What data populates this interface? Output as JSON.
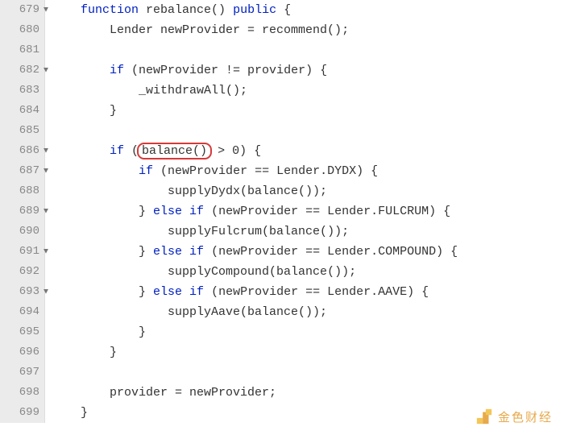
{
  "watermark": {
    "text": "金色财经"
  },
  "lines": [
    {
      "num": "679",
      "fold": true,
      "indent": 4,
      "tokens": [
        {
          "t": "function ",
          "c": "kw"
        },
        {
          "t": "rebalance"
        },
        {
          "t": "() "
        },
        {
          "t": "public",
          "c": "kw"
        },
        {
          "t": " {"
        }
      ]
    },
    {
      "num": "680",
      "fold": false,
      "indent": 8,
      "tokens": [
        {
          "t": "Lender newProvider = recommend();"
        }
      ]
    },
    {
      "num": "681",
      "fold": false,
      "indent": 0,
      "tokens": []
    },
    {
      "num": "682",
      "fold": true,
      "indent": 8,
      "tokens": [
        {
          "t": "if",
          "c": "kw"
        },
        {
          "t": " (newProvider != provider) {"
        }
      ]
    },
    {
      "num": "683",
      "fold": false,
      "indent": 12,
      "tokens": [
        {
          "t": "_withdrawAll();"
        }
      ]
    },
    {
      "num": "684",
      "fold": false,
      "indent": 8,
      "tokens": [
        {
          "t": "}"
        }
      ]
    },
    {
      "num": "685",
      "fold": false,
      "indent": 0,
      "tokens": []
    },
    {
      "num": "686",
      "fold": true,
      "indent": 8,
      "tokens": [
        {
          "t": "if",
          "c": "kw"
        },
        {
          "t": " ("
        },
        {
          "t": "balance()",
          "hl": true
        },
        {
          "t": " > 0) {"
        }
      ]
    },
    {
      "num": "687",
      "fold": true,
      "indent": 12,
      "tokens": [
        {
          "t": "if",
          "c": "kw"
        },
        {
          "t": " (newProvider == Lender.DYDX) {"
        }
      ]
    },
    {
      "num": "688",
      "fold": false,
      "indent": 16,
      "tokens": [
        {
          "t": "supplyDydx(balance());"
        }
      ]
    },
    {
      "num": "689",
      "fold": true,
      "indent": 12,
      "tokens": [
        {
          "t": "} "
        },
        {
          "t": "else if",
          "c": "kw"
        },
        {
          "t": " (newProvider == Lender.FULCRUM) {"
        }
      ]
    },
    {
      "num": "690",
      "fold": false,
      "indent": 16,
      "tokens": [
        {
          "t": "supplyFulcrum(balance());"
        }
      ]
    },
    {
      "num": "691",
      "fold": true,
      "indent": 12,
      "tokens": [
        {
          "t": "} "
        },
        {
          "t": "else if",
          "c": "kw"
        },
        {
          "t": " (newProvider == Lender.COMPOUND) {"
        }
      ]
    },
    {
      "num": "692",
      "fold": false,
      "indent": 16,
      "tokens": [
        {
          "t": "supplyCompound(balance());"
        }
      ]
    },
    {
      "num": "693",
      "fold": true,
      "indent": 12,
      "tokens": [
        {
          "t": "} "
        },
        {
          "t": "else if",
          "c": "kw"
        },
        {
          "t": " (newProvider == Lender.AAVE) {"
        }
      ]
    },
    {
      "num": "694",
      "fold": false,
      "indent": 16,
      "tokens": [
        {
          "t": "supplyAave(balance());"
        }
      ]
    },
    {
      "num": "695",
      "fold": false,
      "indent": 12,
      "tokens": [
        {
          "t": "}"
        }
      ]
    },
    {
      "num": "696",
      "fold": false,
      "indent": 8,
      "tokens": [
        {
          "t": "}"
        }
      ]
    },
    {
      "num": "697",
      "fold": false,
      "indent": 0,
      "tokens": []
    },
    {
      "num": "698",
      "fold": false,
      "indent": 8,
      "tokens": [
        {
          "t": "provider = newProvider;"
        }
      ]
    },
    {
      "num": "699",
      "fold": false,
      "indent": 4,
      "tokens": [
        {
          "t": "}"
        }
      ]
    }
  ]
}
